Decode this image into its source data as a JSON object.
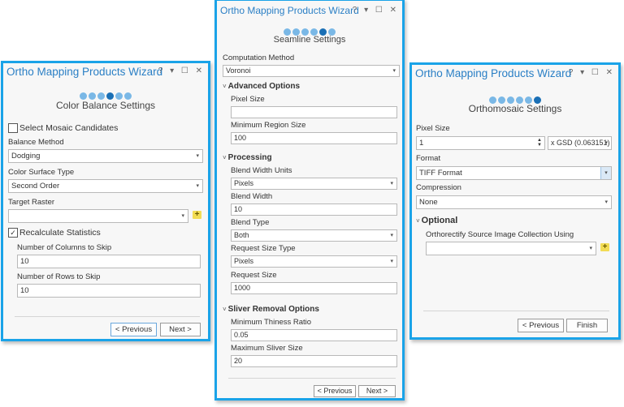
{
  "window_controls": "? ▾ ☐ ✕",
  "left": {
    "title": "Ortho Mapping Products Wizard",
    "step_total": 6,
    "step_active": 4,
    "step_title": "Color Balance Settings",
    "select_mosaic_candidates": {
      "label": "Select Mosaic Candidates",
      "checked": false
    },
    "balance_method": {
      "label": "Balance Method",
      "value": "Dodging"
    },
    "color_surface_type": {
      "label": "Color Surface Type",
      "value": "Second Order"
    },
    "target_raster": {
      "label": "Target Raster",
      "value": ""
    },
    "recalculate_statistics": {
      "label": "Recalculate Statistics",
      "checked": true,
      "mark": "✓"
    },
    "columns_to_skip": {
      "label": "Number of Columns to Skip",
      "value": "10"
    },
    "rows_to_skip": {
      "label": "Number of Rows to Skip",
      "value": "10"
    },
    "previous_label": "< Previous",
    "next_label": "Next >"
  },
  "middle": {
    "title": "Ortho Mapping Products Wizard",
    "step_total": 6,
    "step_active": 5,
    "step_title": "Seamline Settings",
    "computation_method": {
      "label": "Computation Method",
      "value": "Voronoi"
    },
    "advanced_options": "Advanced Options",
    "pixel_size": {
      "label": "Pixel Size",
      "value": ""
    },
    "min_region_size": {
      "label": "Minimum Region Size",
      "value": "100"
    },
    "processing": "Processing",
    "blend_width_units": {
      "label": "Blend Width Units",
      "value": "Pixels"
    },
    "blend_width": {
      "label": "Blend Width",
      "value": "10"
    },
    "blend_type": {
      "label": "Blend Type",
      "value": "Both"
    },
    "request_size_type": {
      "label": "Request Size Type",
      "value": "Pixels"
    },
    "request_size": {
      "label": "Request Size",
      "value": "1000"
    },
    "sliver_removal": "Sliver Removal Options",
    "min_thiness_ratio": {
      "label": "Minimum Thiness Ratio",
      "value": "0.05"
    },
    "max_sliver_size": {
      "label": "Maximum Sliver Size",
      "value": "20"
    },
    "previous_label": "< Previous",
    "next_label": "Next >"
  },
  "right": {
    "title": "Ortho Mapping Products Wizard",
    "step_total": 6,
    "step_active": 6,
    "step_title": "Orthomosaic Settings",
    "pixel_size": {
      "label": "Pixel Size",
      "value": "1",
      "unit": "x GSD (0.063151)"
    },
    "format": {
      "label": "Format",
      "value": "TIFF Format"
    },
    "compression": {
      "label": "Compression",
      "value": "None"
    },
    "optional": "Optional",
    "orthorectify": {
      "label": "Orthorectify Source Image Collection Using",
      "value": ""
    },
    "previous_label": "< Previous",
    "finish_label": "Finish"
  },
  "icons": {
    "caret": "▾",
    "chevron": "˅",
    "add": "+",
    "spin_up": "▲",
    "spin_down": "▼"
  }
}
